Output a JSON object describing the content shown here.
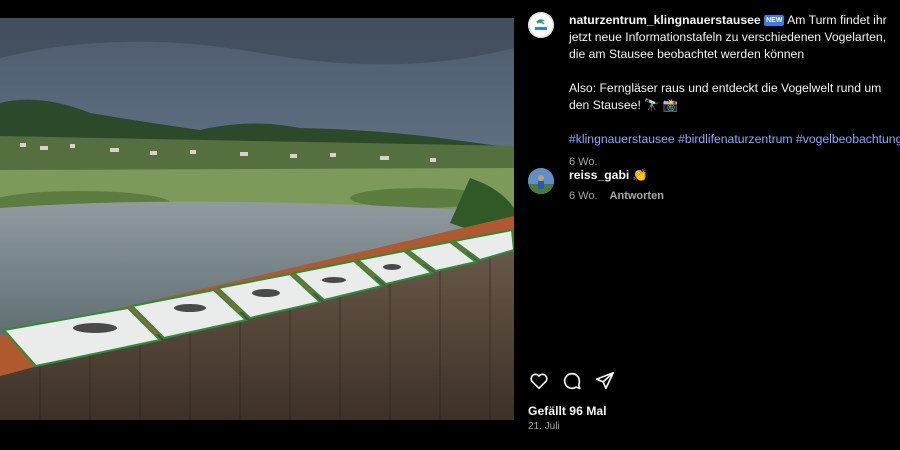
{
  "post": {
    "username": "naturzentrum_klingnauerstausee",
    "badge": "NEW",
    "caption_line": "Am Turm findet ihr jetzt neue Informationstafeln zu verschiedenen Vogelarten, die am Stausee beobachtet werden können",
    "caption_para2": "Also: Ferngläser raus und entdeckt die Vogelwelt rund um den Stausee! 🔭 📸",
    "hashtags": "#klingnauerstausee #birdlifenaturzentrum #vogelbeobachtung",
    "time_ago": "6 Wo."
  },
  "comment": {
    "username": "reiss_gabi",
    "text": "👏",
    "time_ago": "6 Wo.",
    "reply_label": "Antworten"
  },
  "footer": {
    "likes": "Gefällt 96 Mal",
    "date": "21. Juli"
  },
  "icons": [
    "heart-icon",
    "comment-icon",
    "share-icon",
    "bookmark-icon"
  ],
  "colors": {
    "background": "#000000",
    "hashtag": "#8aa7ff",
    "muted": "#a8a8a8"
  }
}
